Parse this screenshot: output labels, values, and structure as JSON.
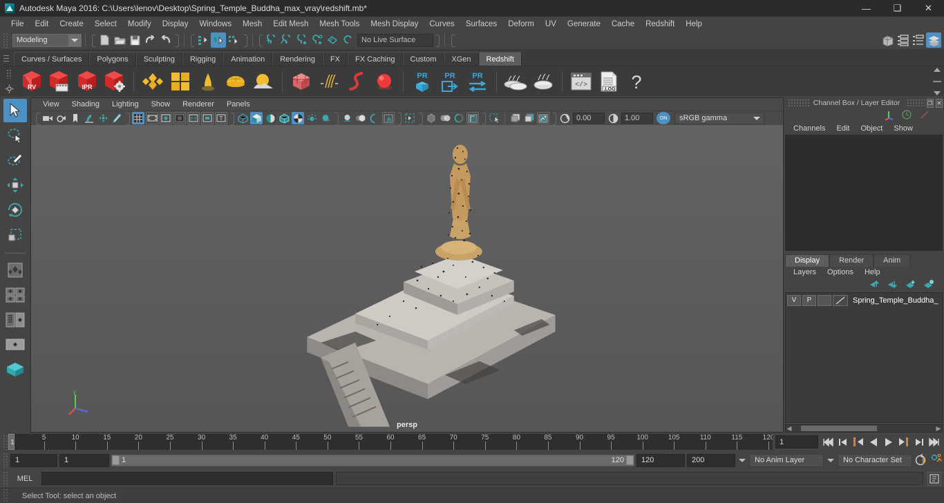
{
  "window": {
    "title": "Autodesk Maya 2016: C:\\Users\\lenov\\Desktop\\Spring_Temple_Buddha_max_vray\\redshift.mb*",
    "app_icon": "maya-logo-icon",
    "minimize": "—",
    "maximize": "❑",
    "close": "✕"
  },
  "menubar": {
    "items": [
      {
        "label": "File"
      },
      {
        "label": "Edit"
      },
      {
        "label": "Create"
      },
      {
        "label": "Select"
      },
      {
        "label": "Modify"
      },
      {
        "label": "Display"
      },
      {
        "label": "Windows"
      },
      {
        "label": "Mesh"
      },
      {
        "label": "Edit Mesh"
      },
      {
        "label": "Mesh Tools"
      },
      {
        "label": "Mesh Display"
      },
      {
        "label": "Curves"
      },
      {
        "label": "Surfaces"
      },
      {
        "label": "Deform"
      },
      {
        "label": "UV"
      },
      {
        "label": "Generate"
      },
      {
        "label": "Cache"
      },
      {
        "label": "Redshift"
      },
      {
        "label": "Help"
      }
    ]
  },
  "statusline": {
    "menu_set": "Modeling",
    "live_surface": "No Live Surface",
    "icons": [
      "new-scene-icon",
      "open-scene-icon",
      "save-scene-icon",
      "undo-icon",
      "redo-icon",
      "select-by-hierarchy-icon",
      "select-by-object-icon",
      "select-by-component-icon",
      "snap-to-grid-icon",
      "snap-to-curve-icon",
      "snap-to-point-icon",
      "snap-to-projected-center-icon",
      "snap-to-view-plane-icon",
      "make-live-icon"
    ],
    "right_icons": [
      "show-hide-modeling-toolkit-icon",
      "show-hide-attribute-editor-icon",
      "show-hide-tool-settings-icon",
      "show-hide-channel-box-icon"
    ]
  },
  "shelf": {
    "tabs": [
      {
        "label": "Curves / Surfaces",
        "active": false
      },
      {
        "label": "Polygons",
        "active": false
      },
      {
        "label": "Sculpting",
        "active": false
      },
      {
        "label": "Rigging",
        "active": false
      },
      {
        "label": "Animation",
        "active": false
      },
      {
        "label": "Rendering",
        "active": false
      },
      {
        "label": "FX",
        "active": false
      },
      {
        "label": "FX Caching",
        "active": false
      },
      {
        "label": "Custom",
        "active": false
      },
      {
        "label": "XGen",
        "active": false
      },
      {
        "label": "Redshift",
        "active": true
      }
    ],
    "buttons": [
      {
        "name": "redshift-render-view-icon",
        "label": "RV"
      },
      {
        "name": "redshift-render-sequence-icon",
        "label": ""
      },
      {
        "name": "redshift-ipr-icon",
        "label": "IPR"
      },
      {
        "name": "redshift-render-settings-icon",
        "label": ""
      },
      {
        "name": "redshift-material-icon",
        "label": ""
      },
      {
        "name": "redshift-material-grid-icon",
        "label": ""
      },
      {
        "name": "redshift-light-dome-icon",
        "label": ""
      },
      {
        "name": "redshift-sphere-light-icon",
        "label": ""
      },
      {
        "name": "redshift-sun-sky-icon",
        "label": ""
      },
      {
        "name": "redshift-proxy-cube-icon",
        "label": ""
      },
      {
        "name": "redshift-hair-icon",
        "label": ""
      },
      {
        "name": "redshift-curve-icon",
        "label": ""
      },
      {
        "name": "redshift-sphere-red-icon",
        "label": ""
      },
      {
        "name": "redshift-proxy-export-pr-icon",
        "label": "PR"
      },
      {
        "name": "redshift-proxy-import-pr-icon",
        "label": "PR"
      },
      {
        "name": "redshift-proxy-transfer-pr-icon",
        "label": "PR"
      },
      {
        "name": "redshift-bake-set-icon",
        "label": ""
      },
      {
        "name": "redshift-bake-icon",
        "label": ""
      },
      {
        "name": "redshift-script-editor-icon",
        "label": ""
      },
      {
        "name": "redshift-log-file-icon",
        "label": ".LOG"
      },
      {
        "name": "redshift-help-icon",
        "label": "?"
      }
    ]
  },
  "toolbox": {
    "tools": [
      {
        "name": "select-tool",
        "active": true
      },
      {
        "name": "lasso-select-tool",
        "active": false
      },
      {
        "name": "paint-select-tool",
        "active": false
      },
      {
        "name": "move-tool",
        "active": false
      },
      {
        "name": "rotate-tool",
        "active": false
      },
      {
        "name": "scale-tool",
        "active": false
      },
      {
        "name": "last-tool-used",
        "active": false
      },
      {
        "name": "single-perspective-layout",
        "active": false
      },
      {
        "name": "four-view-layout",
        "active": false
      },
      {
        "name": "persp-outliner-layout",
        "active": false
      },
      {
        "name": "persp-graph-layout",
        "active": false
      },
      {
        "name": "hypershade-layout",
        "active": false
      }
    ]
  },
  "viewport": {
    "menus": [
      {
        "label": "View"
      },
      {
        "label": "Shading"
      },
      {
        "label": "Lighting"
      },
      {
        "label": "Show"
      },
      {
        "label": "Renderer"
      },
      {
        "label": "Panels"
      }
    ],
    "toolbar_icons": [
      "camera-select-icon",
      "camera-attributes-icon",
      "bookmark-icon",
      "image-plane-icon",
      "two-d-pan-zoom-icon",
      "grease-pencil-icon",
      "grid-toggle-icon",
      "film-gate-icon",
      "resolution-gate-icon",
      "gate-mask-icon",
      "field-chart-icon",
      "safe-action-icon",
      "safe-title-icon",
      "wireframe-icon",
      "smooth-shade-all-icon",
      "shade-selected-items-icon",
      "wireframe-on-shaded-icon",
      "textured-icon",
      "use-default-lighting-icon",
      "shadows-icon",
      "screen-space-ambient-occlusion-icon",
      "motion-blur-icon",
      "multisample-anti-aliasing-icon",
      "depth-of-field-icon",
      "isolate-select-icon",
      "xray-icon",
      "xray-joints-icon",
      "xray-active-components-icon"
    ],
    "exposure": "0.00",
    "gamma": "1.00",
    "color_toggle": "ON",
    "view_transform": "sRGB gamma",
    "camera_label": "persp"
  },
  "channel_box": {
    "panel_title": "Channel Box / Layer Editor",
    "float_button": "❐",
    "close_button": "✕",
    "header_icons": [
      "axis-tripod-icon",
      "clock-icon",
      "red-slash-icon"
    ],
    "menus": [
      {
        "label": "Channels"
      },
      {
        "label": "Edit"
      },
      {
        "label": "Object"
      },
      {
        "label": "Show"
      }
    ]
  },
  "layer_editor": {
    "tabs": [
      {
        "label": "Display",
        "active": true
      },
      {
        "label": "Render",
        "active": false
      },
      {
        "label": "Anim",
        "active": false
      }
    ],
    "menus": [
      {
        "label": "Layers"
      },
      {
        "label": "Options"
      },
      {
        "label": "Help"
      }
    ],
    "tool_icons": [
      "move-layer-up-icon",
      "move-layer-down-icon",
      "new-layer-icon",
      "new-layer-from-selected-icon"
    ],
    "layers": [
      {
        "visibility": "V",
        "playback": "P",
        "type": "",
        "name": "Spring_Temple_Buddha_"
      }
    ]
  },
  "time_slider": {
    "ticks": [
      {
        "value": "5"
      },
      {
        "value": "10"
      },
      {
        "value": "15"
      },
      {
        "value": "20"
      },
      {
        "value": "25"
      },
      {
        "value": "30"
      },
      {
        "value": "35"
      },
      {
        "value": "40"
      },
      {
        "value": "45"
      },
      {
        "value": "50"
      },
      {
        "value": "55"
      },
      {
        "value": "60"
      },
      {
        "value": "65"
      },
      {
        "value": "70"
      },
      {
        "value": "75"
      },
      {
        "value": "80"
      },
      {
        "value": "85"
      },
      {
        "value": "90"
      },
      {
        "value": "95"
      },
      {
        "value": "100"
      },
      {
        "value": "105"
      },
      {
        "value": "110"
      },
      {
        "value": "115"
      },
      {
        "value": "120"
      }
    ],
    "current_frame_marker": "1",
    "current_frame_field": "1",
    "playback_buttons": [
      "go-to-start-icon",
      "step-back-frame-icon",
      "step-back-key-icon",
      "play-backwards-icon",
      "play-forwards-icon",
      "step-forward-key-icon",
      "step-forward-frame-icon",
      "go-to-end-icon"
    ]
  },
  "range_slider": {
    "range_start": "1",
    "anim_start": "1",
    "bar_start_label": "1",
    "bar_end_label": "120",
    "anim_end": "120",
    "range_end": "200",
    "anim_layer": "No Anim Layer",
    "character_set": "No Character Set",
    "right_icons": [
      "auto-keyframe-icon",
      "animation-preferences-icon"
    ]
  },
  "command_line": {
    "language": "MEL",
    "input_value": "",
    "output_value": "",
    "script_editor_icon": "script-editor-icon"
  },
  "status_bar": {
    "help_text": "Select Tool: select an object"
  },
  "colors": {
    "accent_blue": "#4c90c4",
    "panel_bg": "#444444",
    "dark_bg": "#2e2e2e",
    "redshift_red": "#e03c3c",
    "teal": "#3ba7ae",
    "orange": "#d97a2b"
  }
}
